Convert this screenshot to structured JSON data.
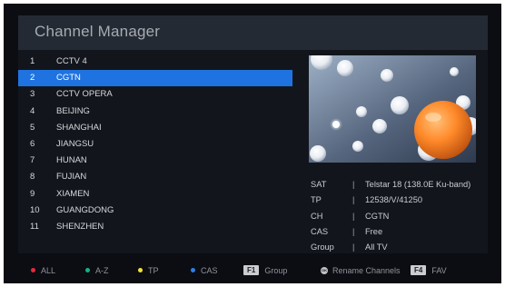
{
  "header": {
    "title": "Channel Manager"
  },
  "channels": [
    {
      "num": "1",
      "name": "CCTV 4"
    },
    {
      "num": "2",
      "name": "CGTN",
      "selected": true
    },
    {
      "num": "3",
      "name": "CCTV OPERA"
    },
    {
      "num": "4",
      "name": "BEIJING"
    },
    {
      "num": "5",
      "name": "SHANGHAI"
    },
    {
      "num": "6",
      "name": "JIANGSU"
    },
    {
      "num": "7",
      "name": "HUNAN"
    },
    {
      "num": "8",
      "name": "FUJIAN"
    },
    {
      "num": "9",
      "name": "XIAMEN"
    },
    {
      "num": "10",
      "name": "GUANGDONG"
    },
    {
      "num": "11",
      "name": "SHENZHEN"
    }
  ],
  "info": [
    {
      "key": "SAT",
      "sep": "|",
      "value": "Telstar 18 (138.0E Ku-band)"
    },
    {
      "key": "TP",
      "sep": "|",
      "value": "12538/V/41250"
    },
    {
      "key": "CH",
      "sep": "|",
      "value": "CGTN"
    },
    {
      "key": "CAS",
      "sep": "|",
      "value": "Free"
    },
    {
      "key": "Group",
      "sep": "|",
      "value": "All TV"
    }
  ],
  "footer": {
    "all": {
      "label": "ALL",
      "color": "#e8283c"
    },
    "az": {
      "label": "A-Z",
      "color": "#16b08a"
    },
    "tp": {
      "label": "TP",
      "color": "#f2e23a"
    },
    "cas": {
      "label": "CAS",
      "color": "#2a7fe8"
    },
    "group": {
      "key": "F1",
      "label": "Group"
    },
    "rename": {
      "key": "OK",
      "label": "Rename Channels"
    },
    "fav": {
      "key": "F4",
      "label": "FAV"
    }
  }
}
